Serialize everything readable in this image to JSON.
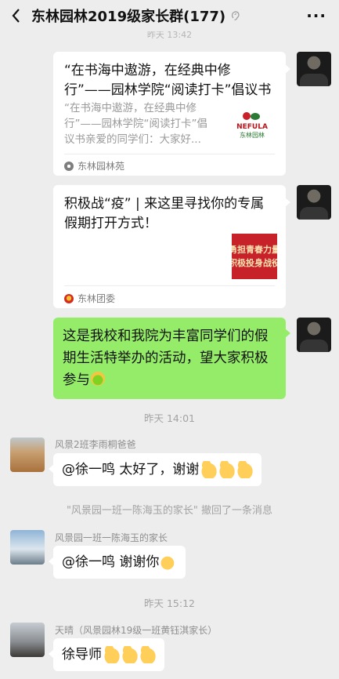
{
  "header": {
    "title": "东林园林2019级家长群(177)",
    "more_label": "···"
  },
  "top_faded_time": "昨天 13:42",
  "messages": {
    "card1": {
      "title": "“在书海中遨游，在经典中修行”——园林学院“阅读打卡”倡议书",
      "desc": "“在书海中遨游，在经典中修行”——园林学院“阅读打卡”倡议书亲爱的同学们：大家好...",
      "thumb_top": "NEFULA",
      "thumb_bottom": "东林园林",
      "source": "东林园林苑"
    },
    "card2": {
      "title": "积极战“疫” | 来这里寻找你的专属假期打开方式！",
      "thumb_line1": "勇担青春力量",
      "thumb_line2": "积极投身战役",
      "source": "东林团委"
    },
    "self_text": "这是我校和我院为丰富同学们的假期生活特举办的活动，望大家积极参与",
    "time1": "昨天 14:01",
    "msg1": {
      "sender": "风景2班李雨桐爸爸",
      "text": "@徐一鸣   太好了，谢谢"
    },
    "system": "\"风景园一班一陈海玉的家长\" 撤回了一条消息",
    "msg2": {
      "sender": "风景园一班一陈海玉的家长",
      "text": "@徐一鸣   谢谢你"
    },
    "time2": "昨天 15:12",
    "msg3": {
      "sender": "天晴（风景园林19级一班黄钰淇家长）",
      "text": "徐导师"
    }
  },
  "icons": {
    "back": "chevron-left-icon",
    "mute": "ear-icon",
    "more": "ellipsis-icon",
    "thumbs_up": "thumbs-up-emoji",
    "ok_hand": "ok-hand-emoji",
    "smile": "smile-emoji"
  },
  "colors": {
    "background": "#ededed",
    "self_bubble": "#95ec69",
    "other_bubble": "#ffffff",
    "secondary_text": "#a3a3a3"
  }
}
